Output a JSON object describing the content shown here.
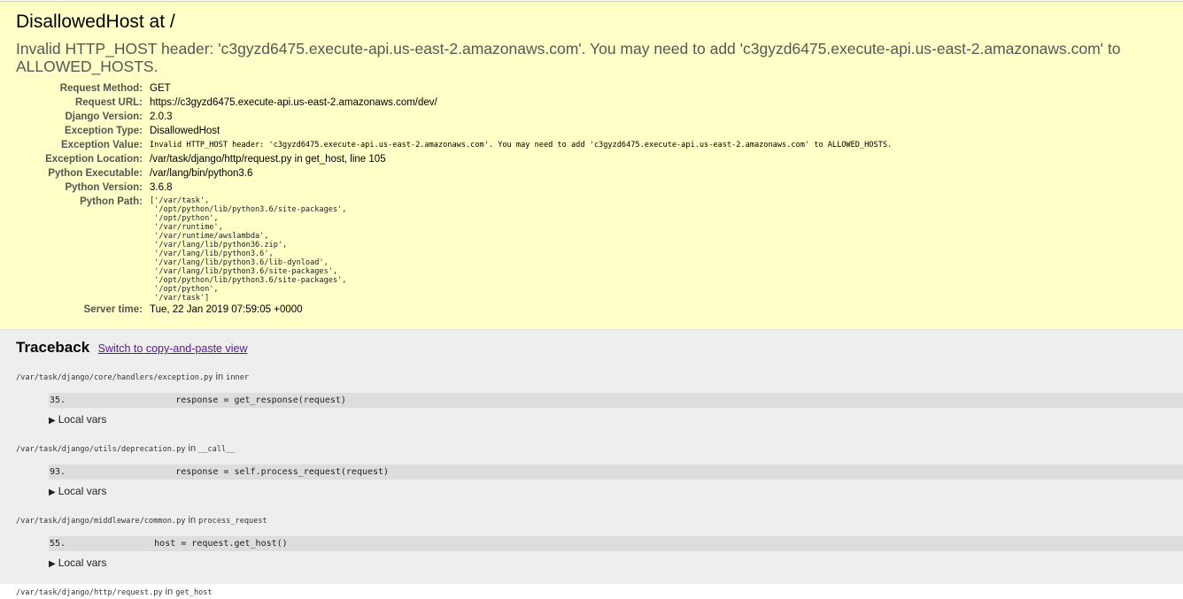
{
  "summary": {
    "title": "DisallowedHost at /",
    "exception_value": "Invalid HTTP_HOST header: 'c3gyzd6475.execute-api.us-east-2.amazonaws.com'. You may need to add 'c3gyzd6475.execute-api.us-east-2.amazonaws.com' to ALLOWED_HOSTS.",
    "rows": {
      "request_method": {
        "label": "Request Method:",
        "value": "GET"
      },
      "request_url": {
        "label": "Request URL:",
        "value": "https://c3gyzd6475.execute-api.us-east-2.amazonaws.com/dev/"
      },
      "django_version": {
        "label": "Django Version:",
        "value": "2.0.3"
      },
      "exception_type": {
        "label": "Exception Type:",
        "value": "DisallowedHost"
      },
      "exception_value": {
        "label": "Exception Value:",
        "value": "Invalid HTTP_HOST header: 'c3gyzd6475.execute-api.us-east-2.amazonaws.com'. You may need to add 'c3gyzd6475.execute-api.us-east-2.amazonaws.com' to ALLOWED_HOSTS."
      },
      "exception_location": {
        "label": "Exception Location:",
        "value": "/var/task/django/http/request.py in get_host, line 105"
      },
      "python_executable": {
        "label": "Python Executable:",
        "value": "/var/lang/bin/python3.6"
      },
      "python_version": {
        "label": "Python Version:",
        "value": "3.6.8"
      },
      "python_path": {
        "label": "Python Path:",
        "value": "['/var/task',\n '/opt/python/lib/python3.6/site-packages',\n '/opt/python',\n '/var/runtime',\n '/var/runtime/awslambda',\n '/var/lang/lib/python36.zip',\n '/var/lang/lib/python3.6',\n '/var/lang/lib/python3.6/lib-dynload',\n '/var/lang/lib/python3.6/site-packages',\n '/opt/python/lib/python3.6/site-packages',\n '/opt/python',\n '/var/task']"
      },
      "server_time": {
        "label": "Server time:",
        "value": "Tue, 22 Jan 2019 07:59:05 +0000"
      }
    }
  },
  "traceback": {
    "title": "Traceback",
    "switch_link": "Switch to copy-and-paste view",
    "in_word": "in",
    "local_vars_label": "Local vars",
    "frames": [
      {
        "file": "/var/task/django/core/handlers/exception.py",
        "function": "inner",
        "lineno": "35.",
        "code": "            response = get_response(request)"
      },
      {
        "file": "/var/task/django/utils/deprecation.py",
        "function": "__call__",
        "lineno": "93.",
        "code": "            response = self.process_request(request)"
      },
      {
        "file": "/var/task/django/middleware/common.py",
        "function": "process_request",
        "lineno": "55.",
        "code": "        host = request.get_host()"
      },
      {
        "file": "/var/task/django/http/request.py",
        "function": "get_host"
      }
    ]
  }
}
